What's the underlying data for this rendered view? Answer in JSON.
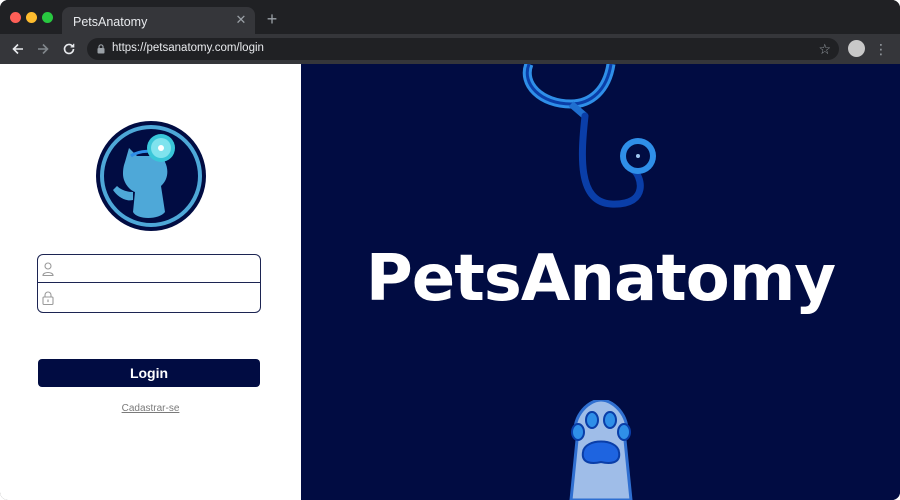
{
  "browser": {
    "tab_title": "PetsAnatomy",
    "tab_close_icon": "close-icon",
    "new_tab_icon": "plus-icon",
    "url": "https://petsanatomy.com/login",
    "back_icon": "arrow-left-icon",
    "forward_icon": "arrow-right-icon",
    "reload_icon": "reload-icon",
    "bookmark_icon": "star-icon",
    "menu_icon": "kebab-menu-icon"
  },
  "login": {
    "username_placeholder": "",
    "password_placeholder": "",
    "button_label": "Login",
    "signup_label": "Cadastrar-se"
  },
  "hero": {
    "brand": "PetsAnatomy"
  },
  "colors": {
    "navy": "#010c42",
    "accent_blue": "#2f8fe8",
    "logo_cat": "#4ea8d8"
  }
}
